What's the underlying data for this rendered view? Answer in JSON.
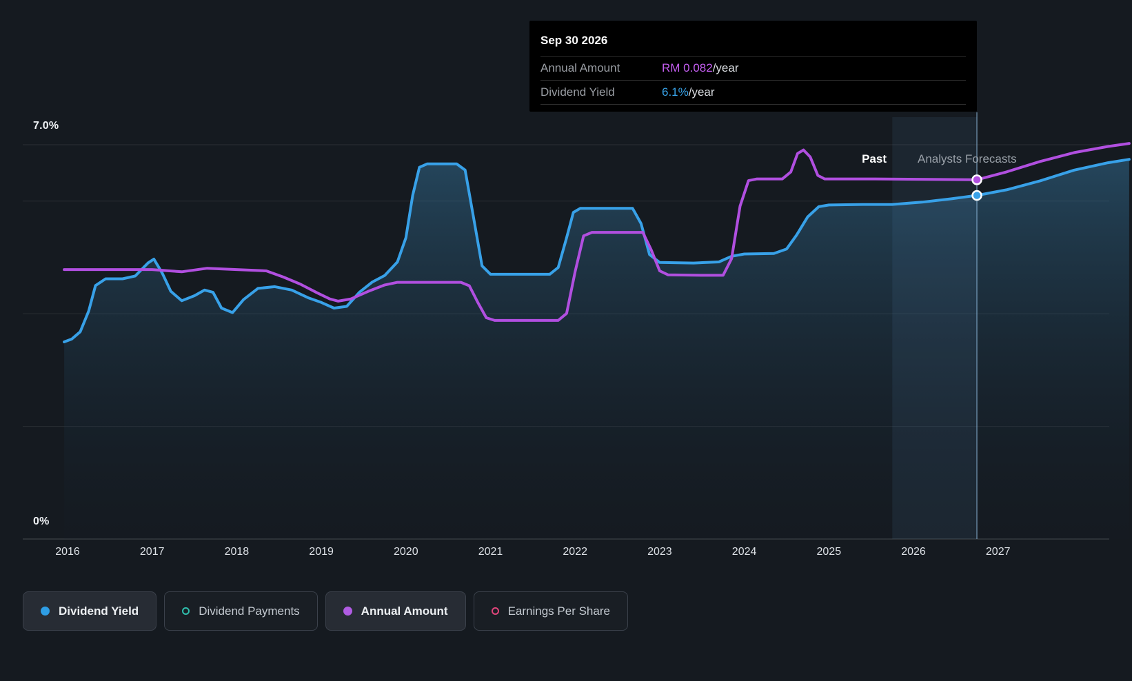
{
  "page": {
    "background": "#151a20"
  },
  "chart": {
    "y_top_label": "7.0%",
    "y_bottom_label": "0%",
    "past_label": "Past",
    "forecast_label": "Analysts Forecasts"
  },
  "tooltip": {
    "date": "Sep 30 2026",
    "rows": [
      {
        "label": "Annual Amount",
        "value": "RM 0.082",
        "suffix": "/year",
        "value_color": "#c45ef0"
      },
      {
        "label": "Dividend Yield",
        "value": "6.1%",
        "suffix": "/year",
        "value_color": "#38a3e9"
      }
    ]
  },
  "legend": {
    "items": [
      {
        "label": "Dividend Yield",
        "marker": "filled-dot",
        "style": "filled",
        "color": "#2e9de4"
      },
      {
        "label": "Dividend Payments",
        "marker": "ring",
        "style": "outlined",
        "color": "#2fbfae"
      },
      {
        "label": "Annual Amount",
        "marker": "filled-dot",
        "style": "filled",
        "color": "#b05ce3"
      },
      {
        "label": "Earnings Per Share",
        "marker": "ring",
        "style": "outlined",
        "color": "#e0457b"
      }
    ]
  },
  "chart_data": {
    "type": "line",
    "title": "Dividend Yield and Annual Amount history with analyst forecasts",
    "x_ticks": [
      2016,
      2017,
      2018,
      2019,
      2020,
      2021,
      2022,
      2023,
      2024,
      2025,
      2026,
      2027
    ],
    "x_range": [
      2015.96,
      2028.58
    ],
    "axes": {
      "percent": {
        "range": [
          0,
          7
        ],
        "gridlines": [
          0,
          2,
          4,
          6,
          7
        ],
        "top_label_value": 7.0
      },
      "amount": {
        "range": [
          0,
          0.09
        ]
      }
    },
    "grid": true,
    "legend_position": "bottom",
    "series": [
      {
        "name": "Dividend Yield",
        "unit": "%",
        "axis": "percent",
        "color": "#38a1e8",
        "area_fill": true,
        "points": [
          [
            2015.96,
            3.5
          ],
          [
            2016.05,
            3.55
          ],
          [
            2016.15,
            3.68
          ],
          [
            2016.25,
            4.05
          ],
          [
            2016.33,
            4.5
          ],
          [
            2016.45,
            4.62
          ],
          [
            2016.65,
            4.62
          ],
          [
            2016.8,
            4.67
          ],
          [
            2016.95,
            4.9
          ],
          [
            2017.02,
            4.97
          ],
          [
            2017.12,
            4.72
          ],
          [
            2017.22,
            4.4
          ],
          [
            2017.35,
            4.23
          ],
          [
            2017.5,
            4.32
          ],
          [
            2017.62,
            4.42
          ],
          [
            2017.72,
            4.38
          ],
          [
            2017.82,
            4.1
          ],
          [
            2017.95,
            4.02
          ],
          [
            2018.08,
            4.25
          ],
          [
            2018.25,
            4.45
          ],
          [
            2018.45,
            4.48
          ],
          [
            2018.65,
            4.42
          ],
          [
            2018.85,
            4.28
          ],
          [
            2019.0,
            4.2
          ],
          [
            2019.15,
            4.1
          ],
          [
            2019.3,
            4.13
          ],
          [
            2019.45,
            4.38
          ],
          [
            2019.6,
            4.56
          ],
          [
            2019.75,
            4.68
          ],
          [
            2019.9,
            4.92
          ],
          [
            2020.0,
            5.35
          ],
          [
            2020.08,
            6.1
          ],
          [
            2020.16,
            6.6
          ],
          [
            2020.25,
            6.66
          ],
          [
            2020.6,
            6.66
          ],
          [
            2020.7,
            6.55
          ],
          [
            2020.8,
            5.7
          ],
          [
            2020.9,
            4.85
          ],
          [
            2021.0,
            4.7
          ],
          [
            2021.4,
            4.7
          ],
          [
            2021.7,
            4.7
          ],
          [
            2021.8,
            4.82
          ],
          [
            2021.9,
            5.35
          ],
          [
            2021.98,
            5.8
          ],
          [
            2022.06,
            5.87
          ],
          [
            2022.4,
            5.87
          ],
          [
            2022.68,
            5.87
          ],
          [
            2022.78,
            5.6
          ],
          [
            2022.88,
            5.05
          ],
          [
            2023.0,
            4.91
          ],
          [
            2023.4,
            4.9
          ],
          [
            2023.7,
            4.92
          ],
          [
            2023.85,
            5.02
          ],
          [
            2024.0,
            5.06
          ],
          [
            2024.35,
            5.07
          ],
          [
            2024.5,
            5.15
          ],
          [
            2024.62,
            5.4
          ],
          [
            2024.75,
            5.72
          ],
          [
            2024.88,
            5.9
          ],
          [
            2025.0,
            5.93
          ],
          [
            2025.4,
            5.94
          ],
          [
            2025.75,
            5.94
          ],
          [
            2026.1,
            5.98
          ],
          [
            2026.45,
            6.04
          ],
          [
            2026.75,
            6.1
          ],
          [
            2027.1,
            6.2
          ],
          [
            2027.5,
            6.36
          ],
          [
            2027.9,
            6.55
          ],
          [
            2028.3,
            6.68
          ],
          [
            2028.55,
            6.74
          ]
        ]
      },
      {
        "name": "Annual Amount",
        "unit": "RM/year",
        "axis": "amount",
        "color": "#b14fe0",
        "area_fill": false,
        "points": [
          [
            2015.96,
            0.0615
          ],
          [
            2016.5,
            0.0615
          ],
          [
            2017.0,
            0.0615
          ],
          [
            2017.35,
            0.061
          ],
          [
            2017.65,
            0.0618
          ],
          [
            2018.0,
            0.0615
          ],
          [
            2018.35,
            0.0612
          ],
          [
            2018.55,
            0.0598
          ],
          [
            2018.75,
            0.0582
          ],
          [
            2018.95,
            0.0562
          ],
          [
            2019.1,
            0.0548
          ],
          [
            2019.2,
            0.0543
          ],
          [
            2019.35,
            0.0548
          ],
          [
            2019.55,
            0.0565
          ],
          [
            2019.75,
            0.058
          ],
          [
            2019.9,
            0.0586
          ],
          [
            2020.3,
            0.0586
          ],
          [
            2020.65,
            0.0586
          ],
          [
            2020.75,
            0.0578
          ],
          [
            2020.85,
            0.054
          ],
          [
            2020.95,
            0.0505
          ],
          [
            2021.05,
            0.0499
          ],
          [
            2021.5,
            0.0499
          ],
          [
            2021.8,
            0.0499
          ],
          [
            2021.9,
            0.0515
          ],
          [
            2022.0,
            0.061
          ],
          [
            2022.1,
            0.0692
          ],
          [
            2022.2,
            0.07
          ],
          [
            2022.6,
            0.07
          ],
          [
            2022.8,
            0.07
          ],
          [
            2022.9,
            0.066
          ],
          [
            2023.0,
            0.0612
          ],
          [
            2023.1,
            0.0603
          ],
          [
            2023.5,
            0.0602
          ],
          [
            2023.75,
            0.0602
          ],
          [
            2023.85,
            0.064
          ],
          [
            2023.95,
            0.076
          ],
          [
            2024.05,
            0.0818
          ],
          [
            2024.15,
            0.0822
          ],
          [
            2024.45,
            0.0822
          ],
          [
            2024.55,
            0.0838
          ],
          [
            2024.63,
            0.088
          ],
          [
            2024.7,
            0.0888
          ],
          [
            2024.78,
            0.0872
          ],
          [
            2024.87,
            0.083
          ],
          [
            2024.95,
            0.0822
          ],
          [
            2025.5,
            0.0822
          ],
          [
            2026.2,
            0.0821
          ],
          [
            2026.75,
            0.082
          ],
          [
            2027.1,
            0.0838
          ],
          [
            2027.5,
            0.0862
          ],
          [
            2027.9,
            0.0882
          ],
          [
            2028.3,
            0.0896
          ],
          [
            2028.55,
            0.0903
          ]
        ]
      }
    ],
    "forecast": {
      "past_label": "Past",
      "forecast_label": "Analysts Forecasts",
      "start_x": 2025.75,
      "marker_x": 2026.75,
      "markers": [
        {
          "series": "Annual Amount",
          "x": 2026.75,
          "value": 0.082,
          "display": "RM 0.082/year"
        },
        {
          "series": "Dividend Yield",
          "x": 2026.75,
          "value": 6.1,
          "display": "6.1%/year"
        }
      ]
    }
  }
}
